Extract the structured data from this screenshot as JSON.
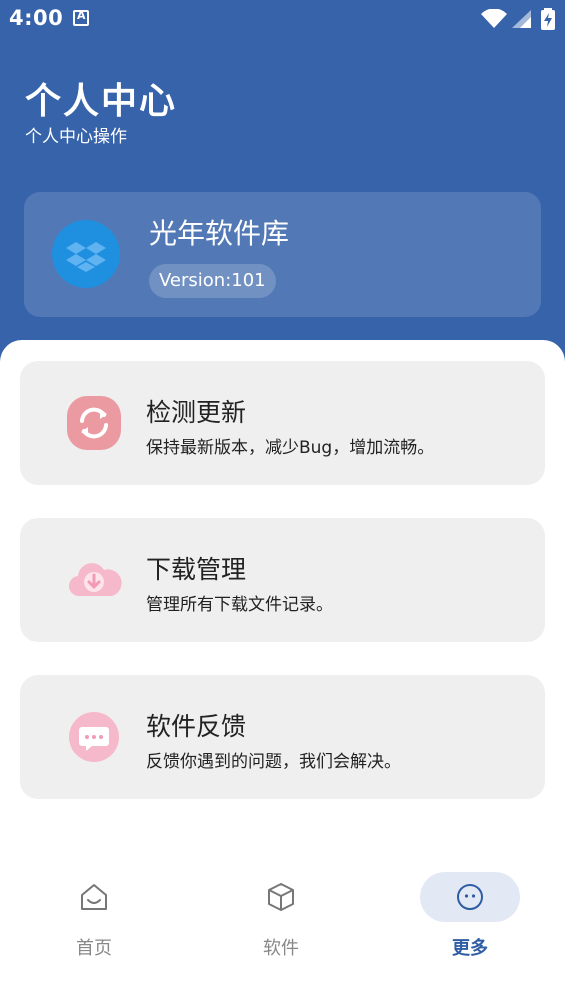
{
  "status_bar": {
    "time": "4:00"
  },
  "header": {
    "title": "个人中心",
    "subtitle": "个人中心操作"
  },
  "app_card": {
    "name": "光年软件库",
    "version": "Version:101"
  },
  "items": [
    {
      "title": "检测更新",
      "desc": "保持最新版本，减少Bug，增加流畅。",
      "icon": "refresh-icon"
    },
    {
      "title": "下载管理",
      "desc": "管理所有下载文件记录。",
      "icon": "cloud-download-icon"
    },
    {
      "title": "软件反馈",
      "desc": "反馈你遇到的问题，我们会解决。",
      "icon": "chat-bubble-icon"
    }
  ],
  "tabs": [
    {
      "label": "首页",
      "icon": "home-icon",
      "active": false
    },
    {
      "label": "软件",
      "icon": "box-icon",
      "active": false
    },
    {
      "label": "更多",
      "icon": "more-icon",
      "active": true
    }
  ],
  "colors": {
    "primary": "#3663aa",
    "accent": "#2f5da3",
    "card_bg": "#efefef",
    "pink": "#f4a6bd"
  }
}
